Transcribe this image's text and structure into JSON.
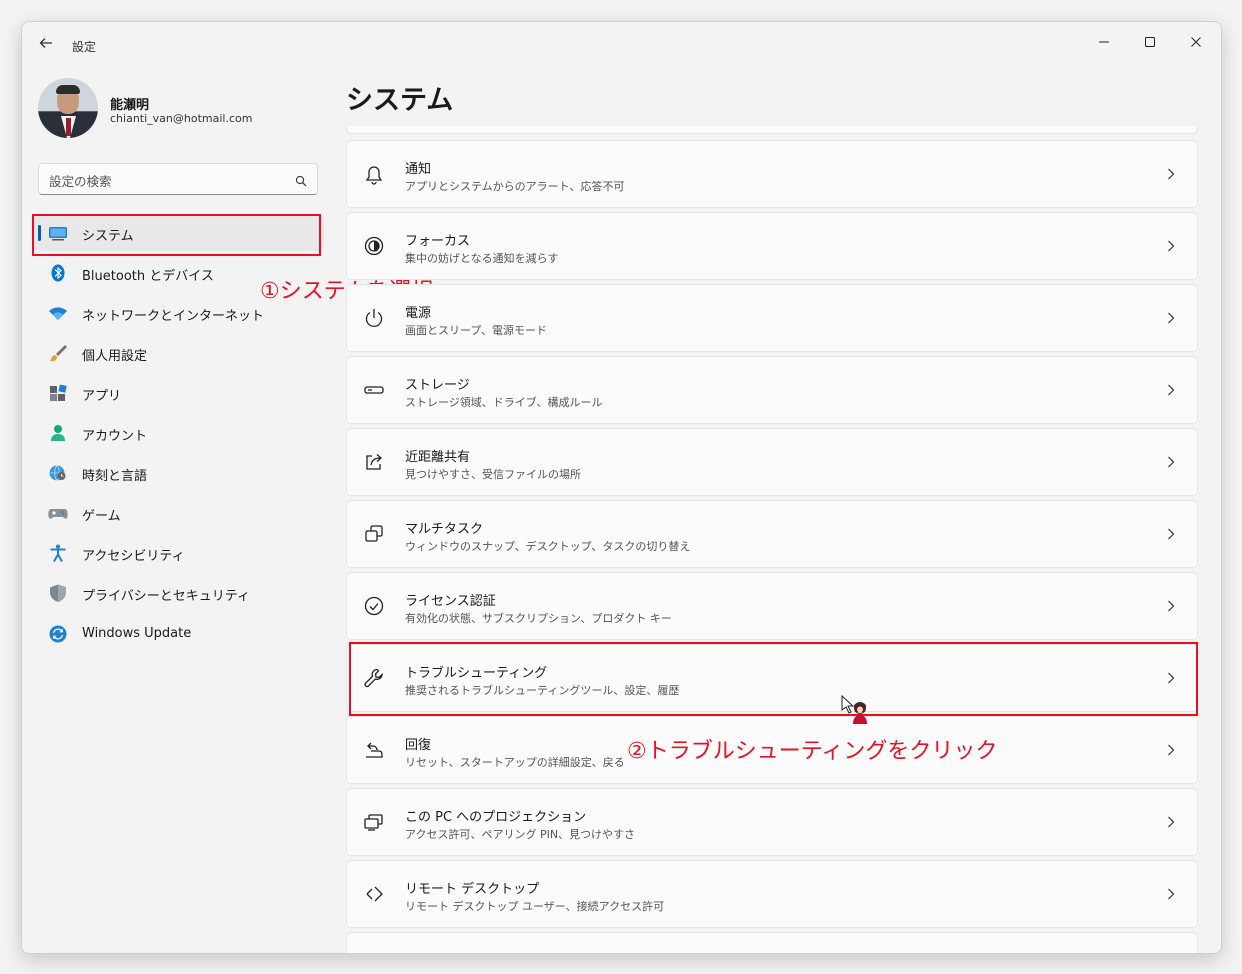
{
  "window": {
    "title": "設定"
  },
  "profile": {
    "name": "能瀬明",
    "email": "chianti_van@hotmail.com"
  },
  "search": {
    "placeholder": "設定の検索"
  },
  "nav": [
    {
      "label": "システム",
      "icon": "monitor-icon",
      "active": true
    },
    {
      "label": "Bluetooth とデバイス",
      "icon": "bluetooth-icon"
    },
    {
      "label": "ネットワークとインターネット",
      "icon": "wifi-icon"
    },
    {
      "label": "個人用設定",
      "icon": "paintbrush-icon"
    },
    {
      "label": "アプリ",
      "icon": "apps-icon"
    },
    {
      "label": "アカウント",
      "icon": "account-icon"
    },
    {
      "label": "時刻と言語",
      "icon": "globe-clock-icon"
    },
    {
      "label": "ゲーム",
      "icon": "gamepad-icon"
    },
    {
      "label": "アクセシビリティ",
      "icon": "accessibility-icon"
    },
    {
      "label": "プライバシーとセキュリティ",
      "icon": "shield-icon"
    },
    {
      "label": "Windows Update",
      "icon": "update-icon"
    }
  ],
  "annotations": {
    "step1": "①システムを選択",
    "step2": "②トラブルシューティングをクリック"
  },
  "main": {
    "heading": "システム",
    "items": [
      {
        "title": "通知",
        "subtitle": "アプリとシステムからのアラート、応答不可",
        "icon": "bell-icon"
      },
      {
        "title": "フォーカス",
        "subtitle": "集中の妨げとなる通知を減らす",
        "icon": "focus-icon"
      },
      {
        "title": "電源",
        "subtitle": "画面とスリープ、電源モード",
        "icon": "power-icon"
      },
      {
        "title": "ストレージ",
        "subtitle": "ストレージ領域、ドライブ、構成ルール",
        "icon": "storage-icon"
      },
      {
        "title": "近距離共有",
        "subtitle": "見つけやすさ、受信ファイルの場所",
        "icon": "share-icon"
      },
      {
        "title": "マルチタスク",
        "subtitle": "ウィンドウのスナップ、デスクトップ、タスクの切り替え",
        "icon": "multitask-icon"
      },
      {
        "title": "ライセンス認証",
        "subtitle": "有効化の状態、サブスクリプション、プロダクト キー",
        "icon": "check-circle-icon"
      },
      {
        "title": "トラブルシューティング",
        "subtitle": "推奨されるトラブルシューティングツール、設定、履歴",
        "icon": "wrench-icon"
      },
      {
        "title": "回復",
        "subtitle": "リセット、スタートアップの詳細設定、戻る",
        "icon": "recovery-icon"
      },
      {
        "title": "この PC へのプロジェクション",
        "subtitle": "アクセス許可、ペアリング PIN、見つけやすさ",
        "icon": "projection-icon"
      },
      {
        "title": "リモート デスクトップ",
        "subtitle": "リモート デスクトップ ユーザー、接続アクセス許可",
        "icon": "remote-desktop-icon"
      }
    ]
  }
}
